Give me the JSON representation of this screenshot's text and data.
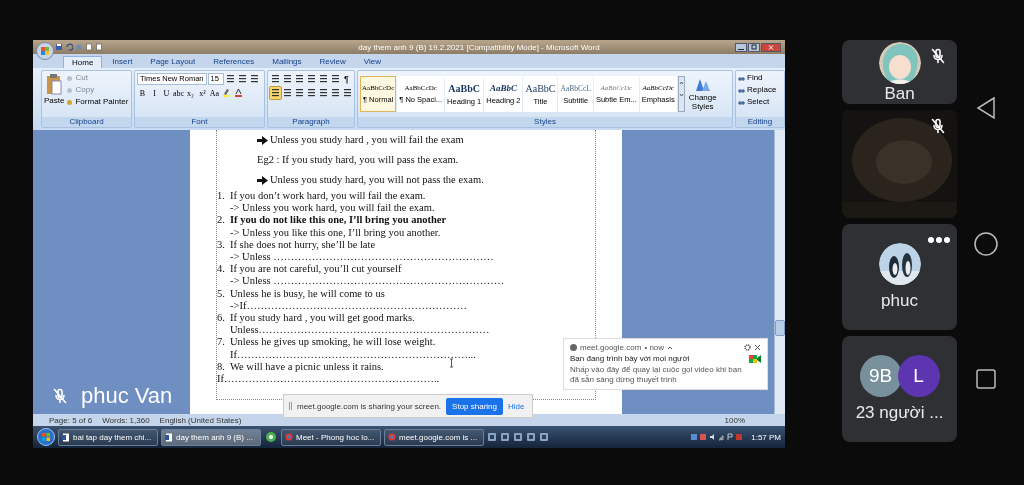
{
  "window": {
    "title": "day them anh 9 (B) 19.2.2021 [Compatibility Mode] - Microsoft Word"
  },
  "ribbon_tabs": [
    {
      "label": "Home",
      "selected": true
    },
    {
      "label": "Insert",
      "selected": false
    },
    {
      "label": "Page Layout",
      "selected": false
    },
    {
      "label": "References",
      "selected": false
    },
    {
      "label": "Mailings",
      "selected": false
    },
    {
      "label": "Review",
      "selected": false
    },
    {
      "label": "View",
      "selected": false
    }
  ],
  "clipboard": {
    "label": "Clipboard",
    "paste": "Paste",
    "items": [
      {
        "label": "Cut",
        "disabled": true
      },
      {
        "label": "Copy",
        "disabled": true
      },
      {
        "label": "Format Painter",
        "disabled": false
      }
    ]
  },
  "font": {
    "label": "Font",
    "family": "Times New Roman",
    "size": "15",
    "buttons": [
      "B",
      "I",
      "U",
      "abc",
      "x₂",
      "x²",
      "Aa"
    ]
  },
  "paragraph": {
    "label": "Paragraph",
    "marks": "¶",
    "align_buttons": [
      {
        "selected": true
      },
      {
        "selected": false
      },
      {
        "selected": false
      },
      {
        "selected": false
      }
    ]
  },
  "styles": {
    "label": "Styles",
    "change": "Change Styles",
    "items": [
      {
        "preview": "AaBbCcDc",
        "name": "¶ Normal",
        "kind": "normal",
        "selected": true
      },
      {
        "preview": "AaBbCcDc",
        "name": "¶ No Spaci...",
        "kind": "normal",
        "selected": false
      },
      {
        "preview": "AaBbC",
        "name": "Heading 1",
        "kind": "heading",
        "selected": false
      },
      {
        "preview": "AaBbC",
        "name": "Heading 2",
        "kind": "heading-italic",
        "selected": false
      },
      {
        "preview": "AaBbC",
        "name": "Title",
        "kind": "title",
        "selected": false
      },
      {
        "preview": "AaBbCcL",
        "name": "Subtitle",
        "kind": "subtitle",
        "selected": false
      },
      {
        "preview": "AaBbCcDc",
        "name": "Subtle Em...",
        "kind": "subtle",
        "selected": false
      },
      {
        "preview": "AaBbCcDc",
        "name": "Emphasis",
        "kind": "emphasis",
        "selected": false
      }
    ]
  },
  "editing": {
    "label": "Editing",
    "items": [
      "Find",
      "Replace",
      "Select"
    ]
  },
  "document": {
    "lines": [
      {
        "kind": "arrow",
        "text": "Unless you study hard , you will fail the exam"
      },
      {
        "kind": "example",
        "text": "Eg2 : If you study hard, you will pass the exam."
      },
      {
        "kind": "arrow",
        "text": "Unless you study hard, you will not pass the exam."
      },
      {
        "kind": "item",
        "number": "1.",
        "text": "If you don’t work hard, you will fail the exam.",
        "bold": false
      },
      {
        "kind": "answer",
        "text": "->  Unless you work hard, you will fail the exam."
      },
      {
        "kind": "item",
        "number": "2.",
        "text": "If you do not like this one, I’ll bring  you another",
        "bold": true
      },
      {
        "kind": "answer",
        "text": "-> Unless you like this one, I’ll bring you another."
      },
      {
        "kind": "item",
        "number": "3.",
        "text": "If she does not hurry, she’ll be late",
        "bold": false
      },
      {
        "kind": "answer",
        "text": "-> Unless ………………………………………………………"
      },
      {
        "kind": "item",
        "number": "4.",
        "text": "If you are not careful, you’ll cut yourself",
        "bold": false
      },
      {
        "kind": "answer",
        "text": "-> Unless …………………………………………………………"
      },
      {
        "kind": "item",
        "number": "5.",
        "text": "Unless he is busy, he will come to us",
        "bold": false
      },
      {
        "kind": "answer",
        "text": "->If………………………………………………………"
      },
      {
        "kind": "item",
        "number": "6.",
        "text": "If you study hard , you will get good marks.",
        "bold": false
      },
      {
        "kind": "answer",
        "text": "Unless…………………………………………………………"
      },
      {
        "kind": "item",
        "number": "7.",
        "text": "Unless he gives up smoking, he will lose weight.",
        "bold": false
      },
      {
        "kind": "answer",
        "text": "If…………………………………………………………..."
      },
      {
        "kind": "item",
        "number": "8.",
        "text": "We will have a picnic unless it rains.",
        "bold": false
      },
      {
        "kind": "plain",
        "text": "If…………………………………………………….."
      }
    ]
  },
  "status_bar": {
    "page": "Page: 5 of 6",
    "words": "Words: 1,360",
    "language": "English (United States)",
    "zoom": "100%"
  },
  "taskbar": {
    "items": [
      {
        "kind": "word",
        "label": "bai tap day them chi...",
        "selected": false
      },
      {
        "kind": "word",
        "label": "day them anh 9 (B) ...",
        "selected": true
      },
      {
        "kind": "chrome",
        "label": "Meet - Phong hoc lo...",
        "selected": false
      },
      {
        "kind": "chrome",
        "label": "meet.google.com is ...",
        "selected": false
      }
    ],
    "time": "1:57 PM"
  },
  "presenter": {
    "name": "phuc Van",
    "muted": true
  },
  "share_bar": {
    "text": "meet.google.com is sharing your screen.",
    "stop": "Stop sharing",
    "hide": "Hide"
  },
  "notification": {
    "source": "meet.google.com",
    "time": "• now",
    "title": "Bạn đang trình bày với mọi người",
    "body": "Nhấp vào đây để quay lại cuộc gọi video khi bạn đã sẵn sàng dừng thuyết trình"
  },
  "participants": [
    {
      "kind": "avatar",
      "name": "Ban",
      "muted": true,
      "menu": false
    },
    {
      "kind": "video",
      "muted": true,
      "menu": false
    },
    {
      "kind": "avatar",
      "name": "phuc",
      "muted": false,
      "menu": true
    },
    {
      "kind": "group",
      "name": "23 người ...",
      "badges": [
        {
          "label": "9B",
          "color": "#78909c"
        },
        {
          "label": "L",
          "color": "#5e35b1"
        }
      ]
    }
  ]
}
